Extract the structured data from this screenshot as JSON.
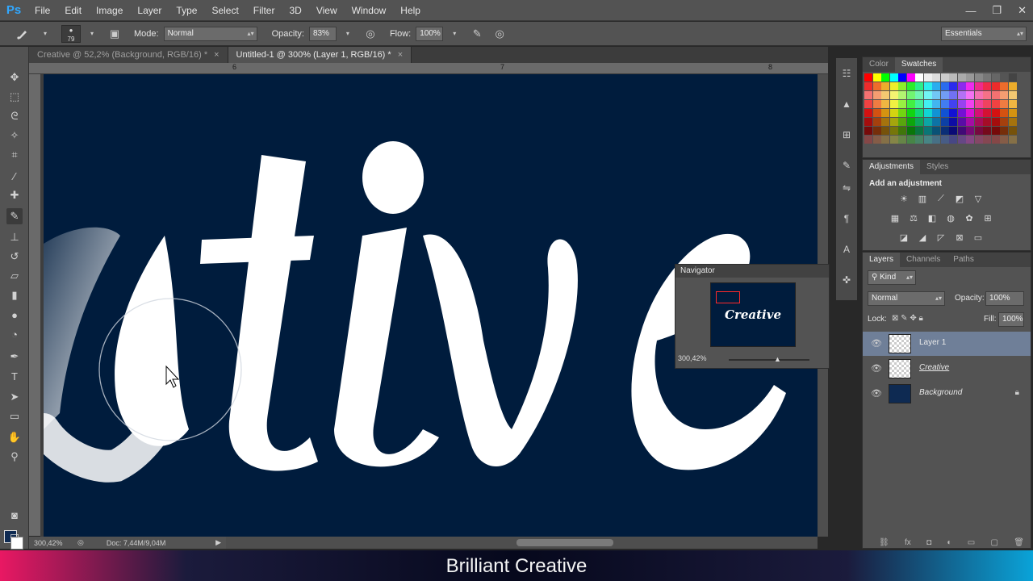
{
  "app": {
    "logo": "Ps"
  },
  "menu": [
    "File",
    "Edit",
    "Image",
    "Layer",
    "Type",
    "Select",
    "Filter",
    "3D",
    "View",
    "Window",
    "Help"
  ],
  "window_controls": [
    "—",
    "❐",
    "✕"
  ],
  "options": {
    "brush_size": "79",
    "mode_label": "Mode:",
    "mode_value": "Normal",
    "opacity_label": "Opacity:",
    "opacity_value": "83%",
    "flow_label": "Flow:",
    "flow_value": "100%",
    "workspace": "Essentials"
  },
  "tabs": [
    {
      "label": "Creative @ 52,2% (Background, RGB/16) *",
      "active": false
    },
    {
      "label": "Untitled-1 @ 300% (Layer 1, RGB/16) *",
      "active": true
    }
  ],
  "ruler_ticks": [
    "6",
    "7",
    "8"
  ],
  "status": {
    "zoom": "300,42%",
    "doc": "Doc: 7,44M/9,04M"
  },
  "navigator": {
    "title": "Navigator",
    "word": "Creative",
    "zoom": "300,42%"
  },
  "swatches_panel": {
    "tabs": [
      "Color",
      "Swatches"
    ],
    "active": "Swatches"
  },
  "adjust_panel": {
    "tabs": [
      "Adjustments",
      "Styles"
    ],
    "active": "Adjustments",
    "title": "Add an adjustment"
  },
  "layers_panel": {
    "tabs": [
      "Layers",
      "Channels",
      "Paths"
    ],
    "active": "Layers",
    "kind_label": "Kind",
    "blend_mode": "Normal",
    "opacity_label": "Opacity:",
    "opacity_value": "100%",
    "lock_label": "Lock:",
    "fill_label": "Fill:",
    "fill_value": "100%",
    "layers": [
      {
        "name": "Layer 1",
        "selected": true
      },
      {
        "name": "Creative",
        "selected": false
      },
      {
        "name": "Background",
        "selected": false
      }
    ]
  },
  "caption": "Brilliant Creative",
  "colors": {
    "canvas_bg": "#001c3d",
    "ui_bg": "#535353",
    "selection": "#6f7f98",
    "nav_box": "#ff2a2a"
  }
}
